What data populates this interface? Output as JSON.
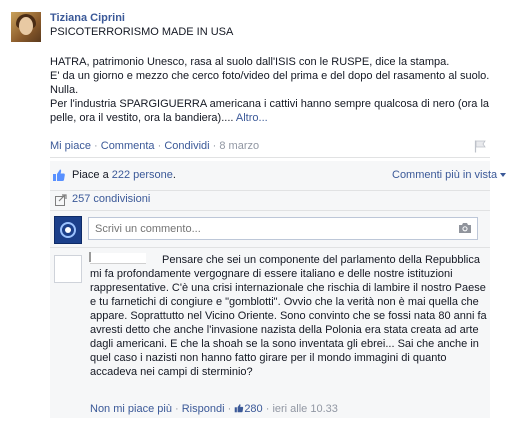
{
  "post": {
    "author": "Tiziana Ciprini",
    "headline": "PSICOTERRORISMO MADE IN USA",
    "paragraphs": [
      "HATRA, patrimonio Unesco, rasa al suolo dall'ISIS con le RUSPE, dice la stampa.",
      "E' da un giorno e mezzo che cerco foto/video del prima e del dopo del rasamento al suolo. Nulla.",
      "Per l'industria SPARGIGUERRA americana i cattivi hanno sempre qualcosa di nero (ora la pelle, ora il vestito, ora la bandiera)...."
    ],
    "more_link": "Altro...",
    "actions": {
      "like": "Mi piace",
      "sep": " · ",
      "comment": "Commenta",
      "share": "Condividi",
      "date": "8 marzo"
    }
  },
  "likes": {
    "prefix": "Piace a ",
    "count_link": "222 persone",
    "suffix": ".",
    "sort_label": "Commenti più in vista"
  },
  "shares": {
    "label": "257 condivisioni"
  },
  "comment_box": {
    "placeholder": "Scrivi un commento..."
  },
  "comment": {
    "text": "Pensare che sei un componente del parlamento della Repubblica mi fa profondamente vergognare di essere italiano e delle nostre istituzioni rappresentative. C'è una crisi internazionale che rischia di lambire il nostro Paese e tu farnetichi di congiure e \"gomblotti\". Ovvio che la verità non è mai quella che appare. Soprattutto nel Vicino Oriente. Sono convinto che se fossi nata 80 anni fa avresti detto che anche l'invasione nazista della Polonia era stata creata ad arte dagli americani. E che la shoah se la sono inventata gli ebrei... Sai che anche in quel caso i nazisti non hanno fatto girare per il mondo immagini di quanto accadeva nei campi di sterminio?",
    "unlike": "Non mi piace più",
    "reply": "Rispondi",
    "like_count": "280",
    "time": "ieri alle 10.33"
  },
  "colors": {
    "link": "#3b5998",
    "muted": "#9197a3",
    "panel": "#f6f7f8"
  },
  "icons": [
    "avatar",
    "flag-icon",
    "thumbs-up-icon",
    "share-icon",
    "camera-icon"
  ]
}
